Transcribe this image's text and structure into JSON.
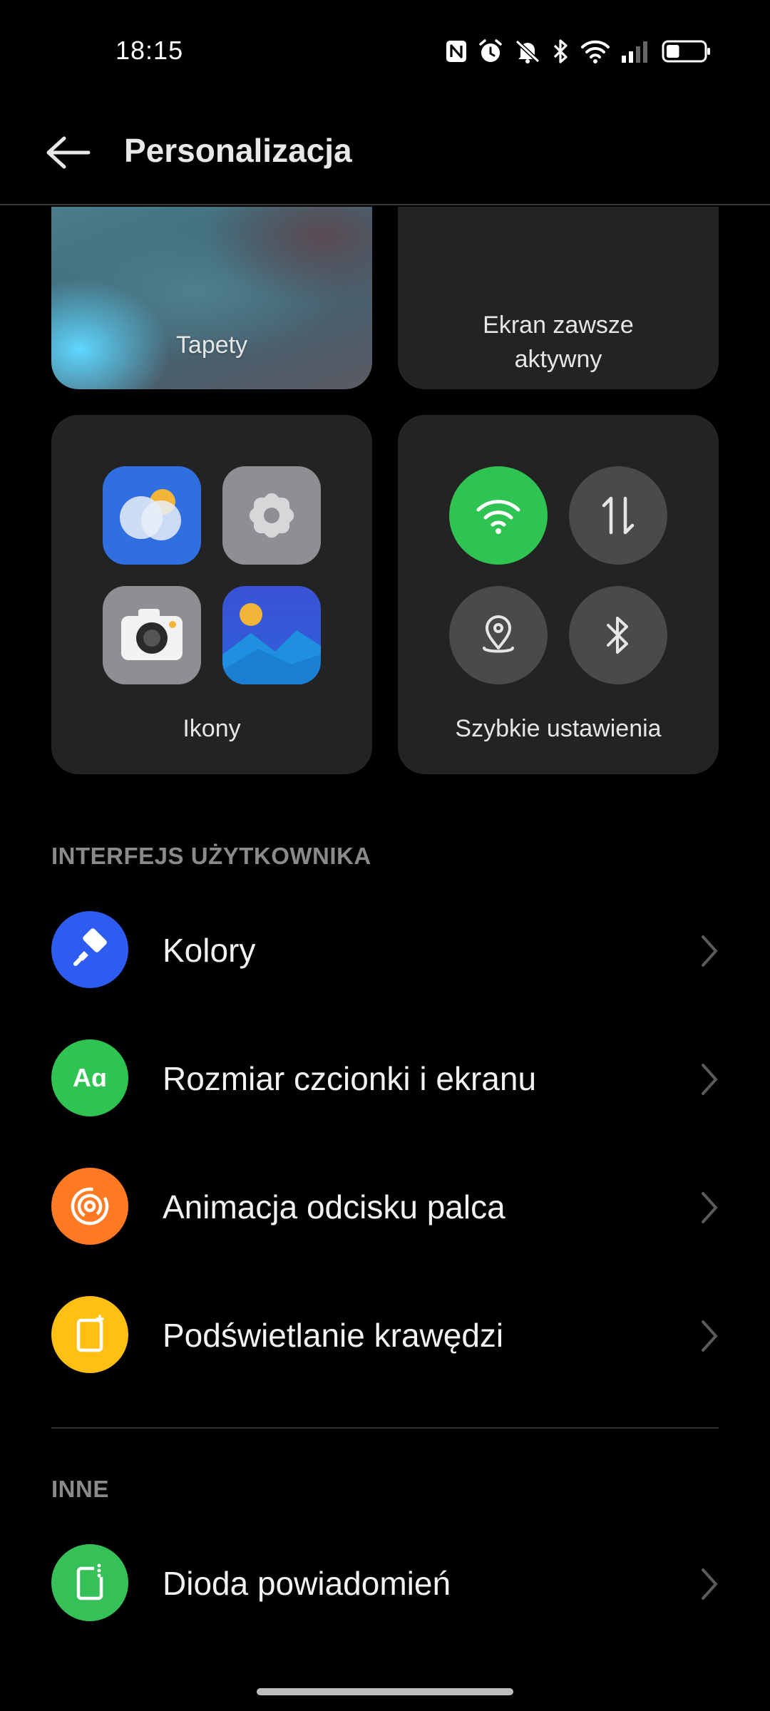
{
  "status_bar": {
    "time": "18:15",
    "battery_percent": 35
  },
  "header": {
    "title": "Personalizacja"
  },
  "cards": {
    "wallpaper_label": "Tapety",
    "aod_label_line1": "Ekran zawsze",
    "aod_label_line2": "aktywny",
    "icons_label": "Ikony",
    "quick_settings_label": "Szybkie ustawienia"
  },
  "sections": {
    "ui_header": "INTERFEJS UŻYTKOWNIKA",
    "ui_items": [
      {
        "label": "Kolory",
        "icon": "paint-roller-icon",
        "color": "#2f5cf0"
      },
      {
        "label": "Rozmiar czcionki i ekranu",
        "icon": "font-size-icon",
        "icon_text": "Aɑ",
        "color": "#2fc351"
      },
      {
        "label": "Animacja odcisku palca",
        "icon": "fingerprint-icon",
        "color": "#ff7a22"
      },
      {
        "label": "Podświetlanie krawędzi",
        "icon": "edge-light-icon",
        "color": "#ffbf13"
      }
    ],
    "other_header": "INNE",
    "other_items": [
      {
        "label": "Dioda powiadomień",
        "icon": "notification-led-icon",
        "color": "#35c158"
      }
    ]
  },
  "colors": {
    "accent_green": "#2fc351",
    "card_bg": "#232323",
    "background": "#000000"
  }
}
